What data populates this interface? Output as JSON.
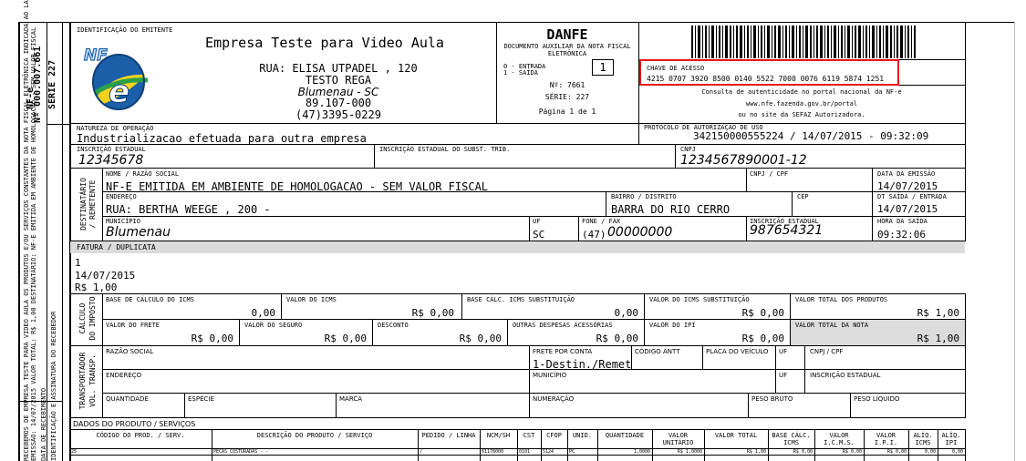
{
  "stub": {
    "nfe_label": "NF-e",
    "number": "Nº  000.007.661",
    "serie": "SÉRIE 227",
    "stub_text_1": "RECEBEMOS DE EMPRESA TESTE PARA VIDEO AULA OS PRODUTOS E/OU SERVIÇOS CONSTANTES DA NOTA FISCAL ELETRÔNICA INDICADA AO LADO.",
    "stub_text_2": "EMISSÃO: 14/07/2015  VALOR TOTAL: R$ 1,00  DESTINATÁRIO: NF-E EMITIDA EM AMBIENTE DE HOMOLOGACAO - SEM VALOR FISCAL",
    "stub_text_3": "DATA DE RECEBIMENTO",
    "stub_text_4": "IDENTIFICAÇÃO E ASSINATURA DO RECEBEDOR"
  },
  "emitente": {
    "section_label": "IDENTIFICAÇÃO DO EMITENTE",
    "logo_text": "NFe",
    "name": "Empresa Teste para Video Aula",
    "address": "RUA: ELISA UTPADEL , 120",
    "district": "TESTO REGA",
    "city": "Blumenau - SC",
    "cep": "89.107-000",
    "phone": "(47)3395-0229"
  },
  "danfe": {
    "title": "DANFE",
    "subtitle": "DOCUMENTO AUXILIAR DA NOTA FISCAL ELETRÔNICA",
    "entrada": "0 - ENTRADA",
    "saida": "1 - SAÍDA",
    "tipo": "1",
    "numero": "Nº: 7661",
    "serie": "SÉRIE: 227",
    "pagina": "Página 1 de 1"
  },
  "chave": {
    "label": "CHAVE DE ACESSO",
    "value": "4215 0707 3920 8500 0140 5522 7000 0076 6119 5874 1251",
    "consulta_1": "Consulta de autenticidade no portal nacional da NF-e",
    "consulta_2": "www.nfe.fazenda.gov.br/portal",
    "consulta_3": "ou no site da SEFAZ Autorizadora."
  },
  "natureza": {
    "label": "NATUREZA DE OPERAÇÃO",
    "value": "Industrializacao efetuada para outra empresa"
  },
  "protocolo": {
    "label": "PROTOCOLO DE AUTORIZAÇÃO DE USO",
    "value": "342150000555224  /  14/07/2015 - 09:32:09"
  },
  "inscricoes": {
    "ie_label": "INSCRIÇÃO ESTADUAL",
    "ie_value": "12345678",
    "ie_st_label": "INSCRIÇÃO ESTADUAL DO SUBST. TRIB.",
    "cnpj_label": "CNPJ",
    "cnpj_value": "1234567890001-12"
  },
  "destinatario": {
    "side_label_1": "DESTINATÁRIO",
    "side_label_2": "/ REMETENTE",
    "nome_label": "NOME / RAZÃO SOCIAL",
    "nome_value": "NF-E EMITIDA EM AMBIENTE DE HOMOLOGACAO - SEM VALOR FISCAL",
    "cnpj_label": "CNPJ / CPF",
    "emissao_label": "DATA DA EMISSÃO",
    "emissao_value": "14/07/2015",
    "endereco_label": "ENDEREÇO",
    "endereco_value": "RUA: BERTHA WEEGE , 200 -",
    "bairro_label": "BAIRRO / DISTRITO",
    "bairro_value": "BARRA DO RIO CERRO",
    "cep_label": "CEP",
    "saida_label": "DT SAÍDA / ENTRADA",
    "saida_value": "14/07/2015",
    "municipio_label": "MUNICÍPIO",
    "municipio_value": "Blumenau",
    "uf_label": "UF",
    "uf_value": "SC",
    "fone_label": "FONE / FAX",
    "fone_ddd": "(47)",
    "fone_value": "00000000",
    "ie_label": "INSCRIÇÃO ESTADUAL",
    "ie_value": "987654321",
    "hora_label": "HORA DA SAÍDA",
    "hora_value": "09:32:06"
  },
  "fatura": {
    "label": "FATURA / DUPLICATA",
    "line1": "1",
    "line2": "14/07/2015",
    "line3": "R$ 1,00"
  },
  "imposto": {
    "side_label_1": "CÁLCULO",
    "side_label_2": "DO IMPOSTO",
    "base_icms_label": "BASE DE CÁLCULO DO ICMS",
    "base_icms_value": "0,00",
    "valor_icms_label": "VALOR DO ICMS",
    "valor_icms_value": "R$ 0,00",
    "base_st_label": "BASE CÁLC. ICMS SUBSTITUIÇÃO",
    "base_st_value": "0,00",
    "valor_st_label": "VALOR DO ICMS SUBSTITUIÇÃO",
    "valor_st_value": "R$ 0,00",
    "total_prod_label": "VALOR TOTAL DOS PRODUTOS",
    "total_prod_value": "R$ 1,00",
    "frete_label": "VALOR DO FRETE",
    "frete_value": "R$ 0,00",
    "seguro_label": "VALOR DO SEGURO",
    "seguro_value": "R$ 0,00",
    "desconto_label": "DESCONTO",
    "desconto_value": "R$ 0,00",
    "outras_label": "OUTRAS DESPESAS ACESSÓRIAS",
    "outras_value": "R$ 0,00",
    "ipi_label": "VALOR DO IPI",
    "ipi_value": "R$ 0,00",
    "total_nota_label": "VALOR TOTAL DA NOTA",
    "total_nota_value": "R$ 1,00"
  },
  "transportador": {
    "side_label_1": "TRANSPORTADOR",
    "side_label_2": "VOL. TRANSP.",
    "razao_label": "RAZÃO SOCIAL",
    "frete_label": "FRETE POR CONTA",
    "frete_value": "1-Destin./Remet",
    "antt_label": "CÓDIGO ANTT",
    "placa_label": "PLACA DO VEÍCULO",
    "uf_label": "UF",
    "cnpj_label": "CNPJ / CPF",
    "endereco_label": "ENDEREÇO",
    "municipio_label": "MUNICÍPIO",
    "uf2_label": "UF",
    "ie_label": "INSCRIÇÃO ESTADUAL",
    "qtd_label": "QUANTIDADE",
    "especie_label": "ESPÉCIE",
    "marca_label": "MARCA",
    "numeracao_label": "NUMERAÇÃO",
    "peso_bruto_label": "PESO BRUTO",
    "peso_liquido_label": "PESO LÍQUIDO"
  },
  "produtos": {
    "label": "DADOS DO PRODUTO / SERVIÇOS",
    "headers": [
      "CÓDIGO DO PROD. / SERV.",
      "DESCRIÇÃO DO PRODUTO / SERVIÇO",
      "PEDIDO / LINHA",
      "NCM/SH",
      "CST",
      "CFOP",
      "UNID.",
      "QUANTIDADE",
      "VALOR UNITÁRIO",
      "VALOR TOTAL",
      "BASE CÁLC. ICMS",
      "VALOR I.C.M.S.",
      "VALOR I.P.I.",
      "ALÍQ. ICMS",
      "ALÍQ. IPI"
    ],
    "rows": [
      [
        "25",
        "PECAS COSTURADAS - -",
        "/",
        "61178000",
        "0101",
        "5124",
        "PC",
        "1,0000",
        "R$ 1,0000",
        "R$ 1,00",
        "R$ 0,00",
        "R$ 0,00",
        "R$ 0,00",
        "0,00",
        "0,00"
      ]
    ]
  },
  "colors": {
    "highlight": "#e8141b",
    "section_bg": "#dcdcdc"
  }
}
